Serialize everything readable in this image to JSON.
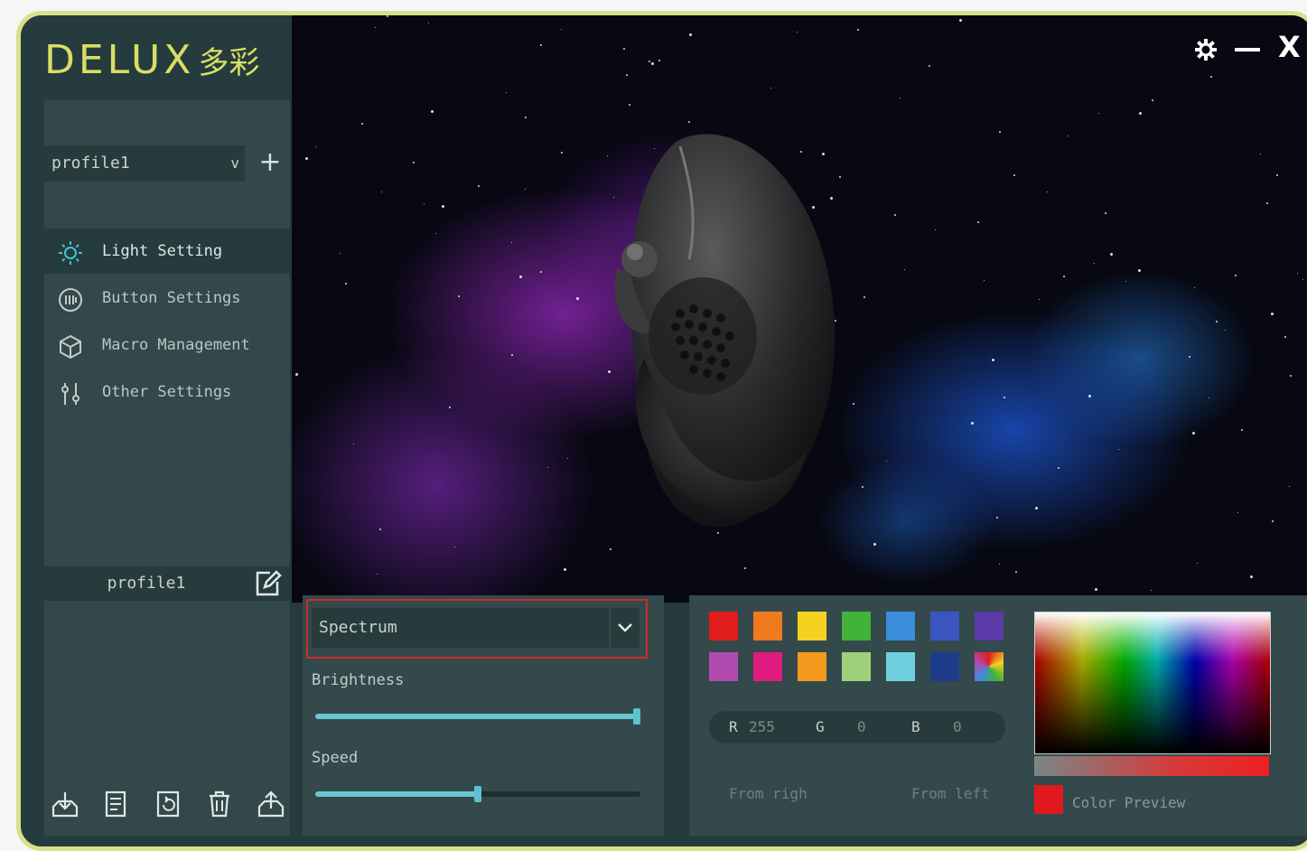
{
  "app": {
    "logo_text": "DELUX",
    "logo_cn": "多彩",
    "accent": "#d8df63",
    "window_controls": [
      "settings-icon",
      "minimize-icon",
      "close-icon"
    ],
    "close_label": "X"
  },
  "profile": {
    "selected": "profile1",
    "add_label": "+",
    "name_field": "profile1"
  },
  "nav": {
    "items": [
      {
        "label": "Light Setting",
        "icon": "light-bulb-icon",
        "active": true
      },
      {
        "label": "Button Settings",
        "icon": "button-grid-icon",
        "active": false
      },
      {
        "label": "Macro Management",
        "icon": "cube-icon",
        "active": false
      },
      {
        "label": "Other Settings",
        "icon": "sliders-icon",
        "active": false
      }
    ]
  },
  "toolbar_bottom": [
    "import-icon",
    "copy-icon",
    "reset-icon",
    "delete-icon",
    "export-icon"
  ],
  "lighting": {
    "mode": "Spectrum",
    "brightness_label": "Brightness",
    "brightness_level": 1.0,
    "speed_label": "Speed",
    "speed_level": 0.5,
    "swatches": [
      "#e11c1c",
      "#f07a1e",
      "#f5d21f",
      "#43b23a",
      "#3b8edb",
      "#3a55c0",
      "#5b3aa8",
      "#b24bb0",
      "#e11c7e",
      "#f59a1e",
      "#9ed07a",
      "#6fd0e0",
      "#1d3d8a",
      "multicolor"
    ],
    "rgb": {
      "r_label": "R",
      "r": "255",
      "g_label": "G",
      "g": "0",
      "b_label": "B",
      "b": "0"
    },
    "from_right": "From righ",
    "from_left": "From left",
    "color_preview_label": "Color Preview",
    "color_preview": "#e1191f"
  }
}
